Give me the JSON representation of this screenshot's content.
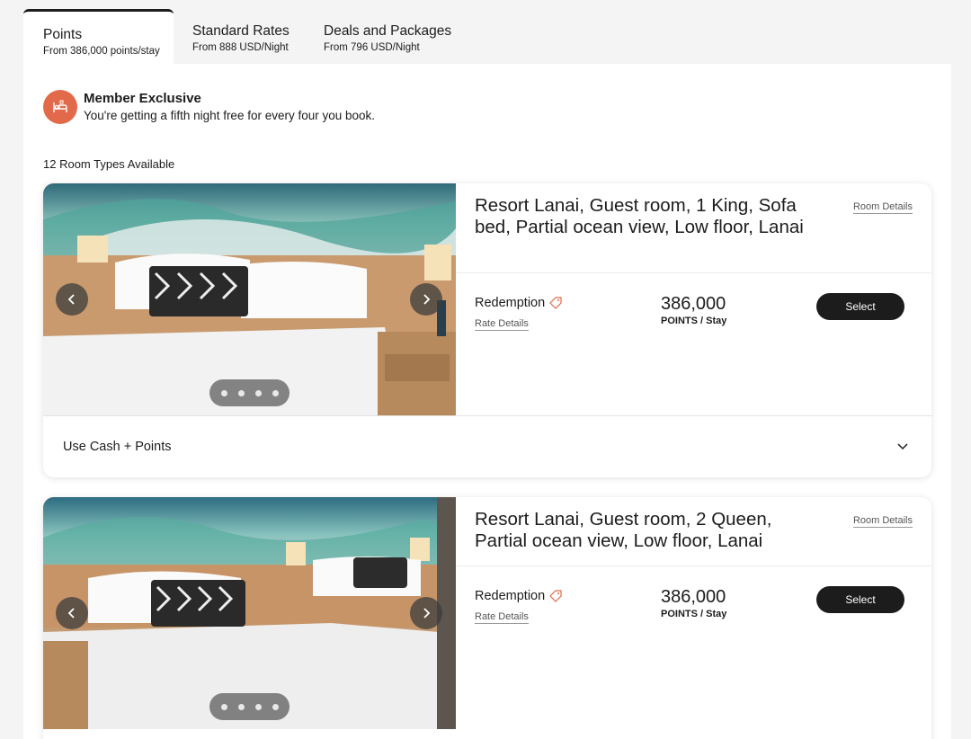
{
  "tabs": [
    {
      "title": "Points",
      "subtitle": "From 386,000 points/stay",
      "active": true
    },
    {
      "title": "Standard Rates",
      "subtitle": "From 888 USD/Night",
      "active": false
    },
    {
      "title": "Deals and Packages",
      "subtitle": "From 796 USD/Night",
      "active": false
    }
  ],
  "member": {
    "title": "Member Exclusive",
    "subtitle": "You're getting a fifth night free for every four you book.",
    "icon": "bed-tag-icon"
  },
  "room_count": "12 Room Types Available",
  "rooms": [
    {
      "title": "Resort Lanai, Guest room, 1 King, Sofa bed, Partial ocean view, Low floor, Lanai",
      "details_link": "Room Details",
      "rate_label": "Redemption",
      "rate_details": "Rate Details",
      "price": "386,000",
      "price_unit": "POINTS / Stay",
      "select": "Select",
      "footer": "Use Cash + Points"
    },
    {
      "title": "Resort Lanai, Guest room, 2 Queen, Partial ocean view, Low floor, Lanai",
      "details_link": "Room Details",
      "rate_label": "Redemption",
      "rate_details": "Rate Details",
      "price": "386,000",
      "price_unit": "POINTS / Stay",
      "select": "Select"
    }
  ],
  "colors": {
    "accent": "#e26a4a",
    "button": "#1c1c1c"
  }
}
